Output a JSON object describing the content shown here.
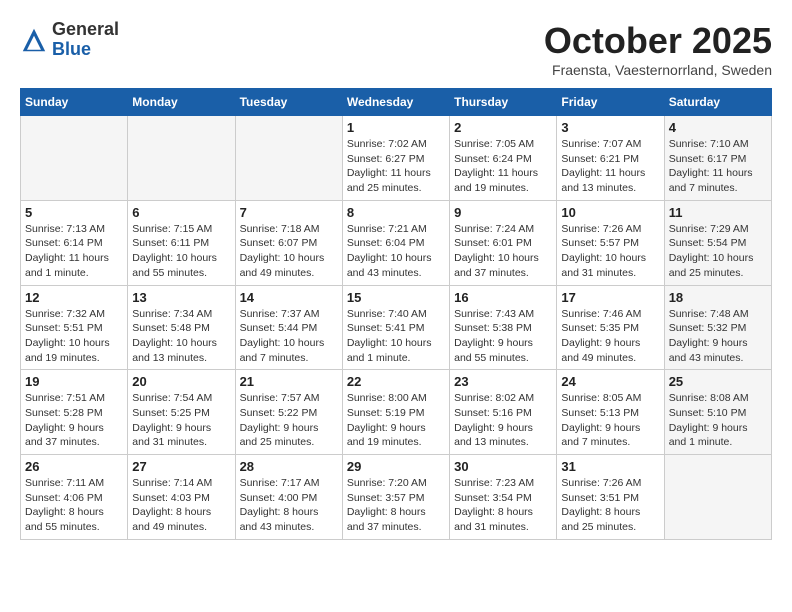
{
  "header": {
    "logo_general": "General",
    "logo_blue": "Blue",
    "month": "October 2025",
    "location": "Fraensta, Vaesternorrland, Sweden"
  },
  "weekdays": [
    "Sunday",
    "Monday",
    "Tuesday",
    "Wednesday",
    "Thursday",
    "Friday",
    "Saturday"
  ],
  "weeks": [
    [
      {
        "day": "",
        "text": "",
        "shade": true
      },
      {
        "day": "",
        "text": "",
        "shade": true
      },
      {
        "day": "",
        "text": "",
        "shade": true
      },
      {
        "day": "1",
        "text": "Sunrise: 7:02 AM\nSunset: 6:27 PM\nDaylight: 11 hours\nand 25 minutes.",
        "shade": false
      },
      {
        "day": "2",
        "text": "Sunrise: 7:05 AM\nSunset: 6:24 PM\nDaylight: 11 hours\nand 19 minutes.",
        "shade": false
      },
      {
        "day": "3",
        "text": "Sunrise: 7:07 AM\nSunset: 6:21 PM\nDaylight: 11 hours\nand 13 minutes.",
        "shade": false
      },
      {
        "day": "4",
        "text": "Sunrise: 7:10 AM\nSunset: 6:17 PM\nDaylight: 11 hours\nand 7 minutes.",
        "shade": true
      }
    ],
    [
      {
        "day": "5",
        "text": "Sunrise: 7:13 AM\nSunset: 6:14 PM\nDaylight: 11 hours\nand 1 minute.",
        "shade": false
      },
      {
        "day": "6",
        "text": "Sunrise: 7:15 AM\nSunset: 6:11 PM\nDaylight: 10 hours\nand 55 minutes.",
        "shade": false
      },
      {
        "day": "7",
        "text": "Sunrise: 7:18 AM\nSunset: 6:07 PM\nDaylight: 10 hours\nand 49 minutes.",
        "shade": false
      },
      {
        "day": "8",
        "text": "Sunrise: 7:21 AM\nSunset: 6:04 PM\nDaylight: 10 hours\nand 43 minutes.",
        "shade": false
      },
      {
        "day": "9",
        "text": "Sunrise: 7:24 AM\nSunset: 6:01 PM\nDaylight: 10 hours\nand 37 minutes.",
        "shade": false
      },
      {
        "day": "10",
        "text": "Sunrise: 7:26 AM\nSunset: 5:57 PM\nDaylight: 10 hours\nand 31 minutes.",
        "shade": false
      },
      {
        "day": "11",
        "text": "Sunrise: 7:29 AM\nSunset: 5:54 PM\nDaylight: 10 hours\nand 25 minutes.",
        "shade": true
      }
    ],
    [
      {
        "day": "12",
        "text": "Sunrise: 7:32 AM\nSunset: 5:51 PM\nDaylight: 10 hours\nand 19 minutes.",
        "shade": false
      },
      {
        "day": "13",
        "text": "Sunrise: 7:34 AM\nSunset: 5:48 PM\nDaylight: 10 hours\nand 13 minutes.",
        "shade": false
      },
      {
        "day": "14",
        "text": "Sunrise: 7:37 AM\nSunset: 5:44 PM\nDaylight: 10 hours\nand 7 minutes.",
        "shade": false
      },
      {
        "day": "15",
        "text": "Sunrise: 7:40 AM\nSunset: 5:41 PM\nDaylight: 10 hours\nand 1 minute.",
        "shade": false
      },
      {
        "day": "16",
        "text": "Sunrise: 7:43 AM\nSunset: 5:38 PM\nDaylight: 9 hours\nand 55 minutes.",
        "shade": false
      },
      {
        "day": "17",
        "text": "Sunrise: 7:46 AM\nSunset: 5:35 PM\nDaylight: 9 hours\nand 49 minutes.",
        "shade": false
      },
      {
        "day": "18",
        "text": "Sunrise: 7:48 AM\nSunset: 5:32 PM\nDaylight: 9 hours\nand 43 minutes.",
        "shade": true
      }
    ],
    [
      {
        "day": "19",
        "text": "Sunrise: 7:51 AM\nSunset: 5:28 PM\nDaylight: 9 hours\nand 37 minutes.",
        "shade": false
      },
      {
        "day": "20",
        "text": "Sunrise: 7:54 AM\nSunset: 5:25 PM\nDaylight: 9 hours\nand 31 minutes.",
        "shade": false
      },
      {
        "day": "21",
        "text": "Sunrise: 7:57 AM\nSunset: 5:22 PM\nDaylight: 9 hours\nand 25 minutes.",
        "shade": false
      },
      {
        "day": "22",
        "text": "Sunrise: 8:00 AM\nSunset: 5:19 PM\nDaylight: 9 hours\nand 19 minutes.",
        "shade": false
      },
      {
        "day": "23",
        "text": "Sunrise: 8:02 AM\nSunset: 5:16 PM\nDaylight: 9 hours\nand 13 minutes.",
        "shade": false
      },
      {
        "day": "24",
        "text": "Sunrise: 8:05 AM\nSunset: 5:13 PM\nDaylight: 9 hours\nand 7 minutes.",
        "shade": false
      },
      {
        "day": "25",
        "text": "Sunrise: 8:08 AM\nSunset: 5:10 PM\nDaylight: 9 hours\nand 1 minute.",
        "shade": true
      }
    ],
    [
      {
        "day": "26",
        "text": "Sunrise: 7:11 AM\nSunset: 4:06 PM\nDaylight: 8 hours\nand 55 minutes.",
        "shade": false
      },
      {
        "day": "27",
        "text": "Sunrise: 7:14 AM\nSunset: 4:03 PM\nDaylight: 8 hours\nand 49 minutes.",
        "shade": false
      },
      {
        "day": "28",
        "text": "Sunrise: 7:17 AM\nSunset: 4:00 PM\nDaylight: 8 hours\nand 43 minutes.",
        "shade": false
      },
      {
        "day": "29",
        "text": "Sunrise: 7:20 AM\nSunset: 3:57 PM\nDaylight: 8 hours\nand 37 minutes.",
        "shade": false
      },
      {
        "day": "30",
        "text": "Sunrise: 7:23 AM\nSunset: 3:54 PM\nDaylight: 8 hours\nand 31 minutes.",
        "shade": false
      },
      {
        "day": "31",
        "text": "Sunrise: 7:26 AM\nSunset: 3:51 PM\nDaylight: 8 hours\nand 25 minutes.",
        "shade": false
      },
      {
        "day": "",
        "text": "",
        "shade": true
      }
    ]
  ]
}
